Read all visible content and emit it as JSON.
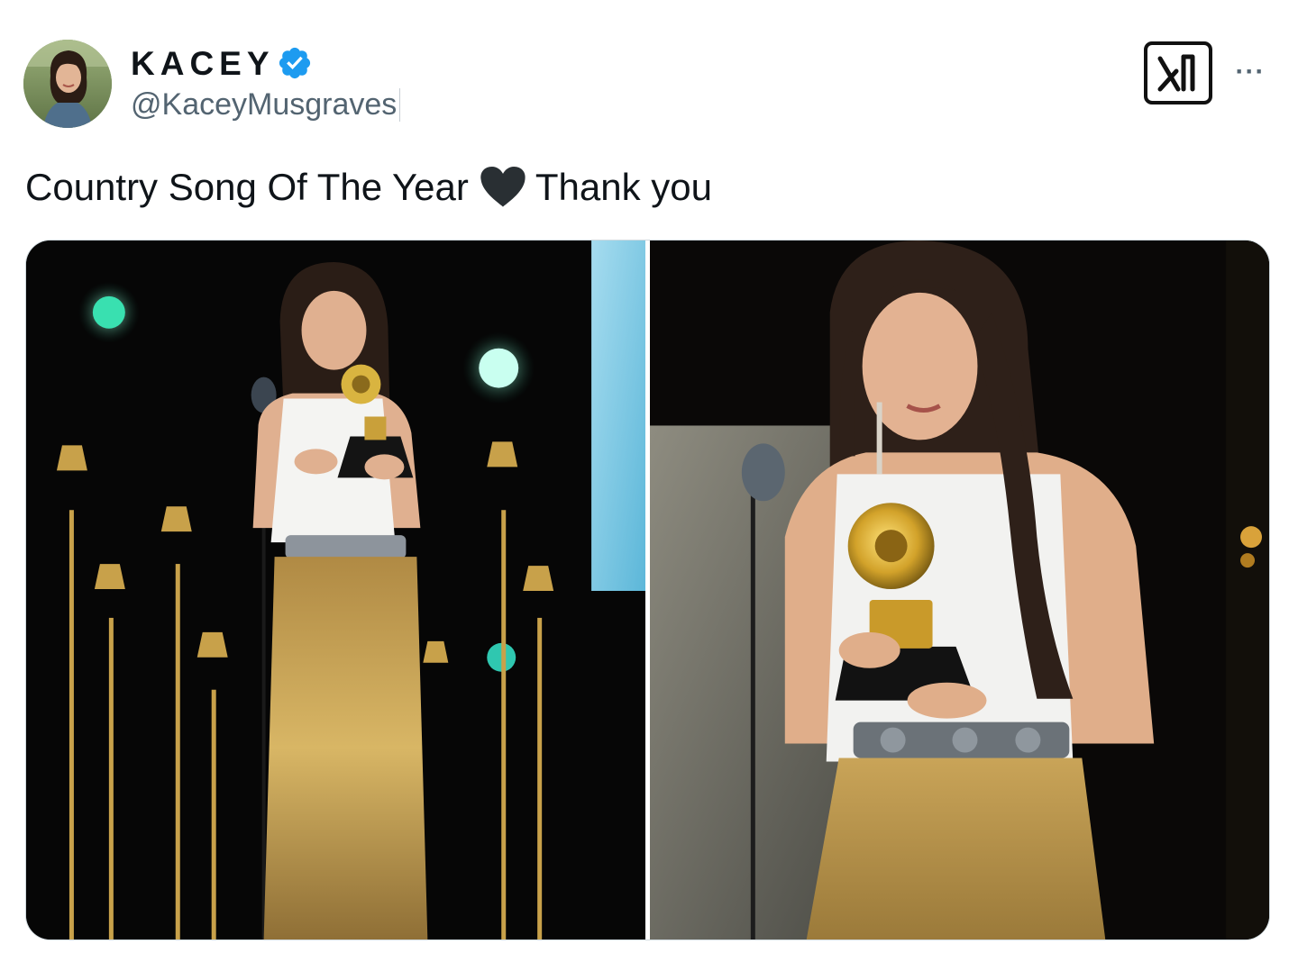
{
  "tweet": {
    "author": {
      "display_name": "KACEY",
      "handle": "@KaceyMusgraves",
      "verified": true,
      "verified_badge_icon": "verified-badge-icon",
      "verified_color": "#1d9bf0"
    },
    "header_actions": {
      "logo_icon": "x-logo-icon",
      "more_icon": "more-icon",
      "more_label": "···"
    },
    "text": {
      "before_emoji": "Country Song Of The Year",
      "emoji": "black-heart-icon",
      "after_emoji": "Thank you"
    },
    "media": [
      {
        "id": "photo-1"
      },
      {
        "id": "photo-2"
      }
    ]
  },
  "colors": {
    "text_primary": "#0f1419",
    "text_secondary": "#536471",
    "border": "#cfd9de"
  }
}
